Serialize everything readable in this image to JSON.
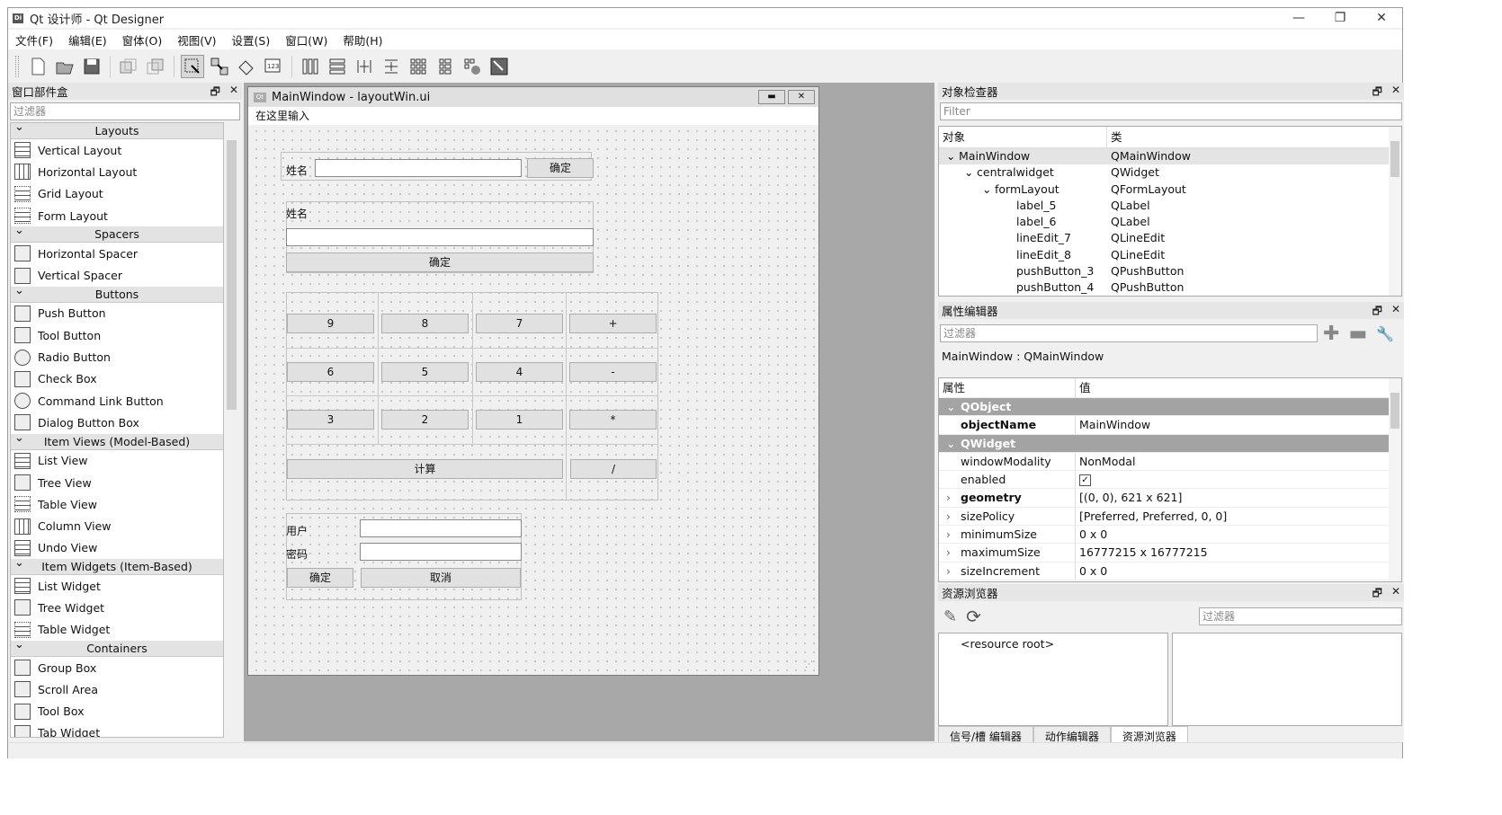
{
  "window": {
    "title": "Qt 设计师 - Qt Designer",
    "icon_label": "Di",
    "minimize": "—",
    "restore": "❐",
    "close": "✕"
  },
  "menu": [
    "文件(F)",
    "编辑(E)",
    "窗体(O)",
    "视图(V)",
    "设置(S)",
    "窗口(W)",
    "帮助(H)"
  ],
  "widget_box": {
    "title": "窗口部件盒",
    "filter_placeholder": "过滤器",
    "categories": [
      {
        "name": "Layouts",
        "items": [
          "Vertical Layout",
          "Horizontal Layout",
          "Grid Layout",
          "Form Layout"
        ]
      },
      {
        "name": "Spacers",
        "items": [
          "Horizontal Spacer",
          "Vertical Spacer"
        ]
      },
      {
        "name": "Buttons",
        "items": [
          "Push Button",
          "Tool Button",
          "Radio Button",
          "Check Box",
          "Command Link Button",
          "Dialog Button Box"
        ]
      },
      {
        "name": "Item Views (Model-Based)",
        "items": [
          "List View",
          "Tree View",
          "Table View",
          "Column View",
          "Undo View"
        ]
      },
      {
        "name": "Item Widgets (Item-Based)",
        "items": [
          "List Widget",
          "Tree Widget",
          "Table Widget"
        ]
      },
      {
        "name": "Containers",
        "items": [
          "Group Box",
          "Scroll Area",
          "Tool Box",
          "Tab Widget"
        ]
      }
    ]
  },
  "form": {
    "title": "MainWindow - layoutWin.ui",
    "icon_label": "Qt",
    "menu_placeholder": "在这里输入",
    "row1_label": "姓名",
    "row1_button": "确定",
    "row2_label": "姓名",
    "row2_button": "确定",
    "grid_buttons": [
      "9",
      "8",
      "7",
      "+",
      "6",
      "5",
      "4",
      "-",
      "3",
      "2",
      "1",
      "*"
    ],
    "calc_button": "计算",
    "div_button": "/",
    "user_label": "用户",
    "pass_label": "密码",
    "ok_button": "确定",
    "cancel_button": "取消"
  },
  "object_inspector": {
    "title": "对象检查器",
    "filter_placeholder": "Filter",
    "col_object": "对象",
    "col_class": "类",
    "rows": [
      {
        "name": "MainWindow",
        "class": "QMainWindow",
        "indent": 0,
        "expand": "⌄"
      },
      {
        "name": "centralwidget",
        "class": "QWidget",
        "indent": 1,
        "expand": "⌄"
      },
      {
        "name": "formLayout",
        "class": "QFormLayout",
        "indent": 2,
        "expand": "⌄"
      },
      {
        "name": "label_5",
        "class": "QLabel",
        "indent": 3,
        "expand": ""
      },
      {
        "name": "label_6",
        "class": "QLabel",
        "indent": 3,
        "expand": ""
      },
      {
        "name": "lineEdit_7",
        "class": "QLineEdit",
        "indent": 3,
        "expand": ""
      },
      {
        "name": "lineEdit_8",
        "class": "QLineEdit",
        "indent": 3,
        "expand": ""
      },
      {
        "name": "pushButton_3",
        "class": "QPushButton",
        "indent": 3,
        "expand": ""
      },
      {
        "name": "pushButton_4",
        "class": "QPushButton",
        "indent": 3,
        "expand": ""
      }
    ]
  },
  "property_editor": {
    "title": "属性编辑器",
    "filter_placeholder": "过滤器",
    "object_class": "MainWindow : QMainWindow",
    "col_property": "属性",
    "col_value": "值",
    "rows": [
      {
        "type": "group",
        "name": "QObject"
      },
      {
        "type": "prop",
        "name": "objectName",
        "value": "MainWindow",
        "bold": true,
        "expandable": false
      },
      {
        "type": "group",
        "name": "QWidget"
      },
      {
        "type": "prop",
        "name": "windowModality",
        "value": "NonModal",
        "bold": false,
        "expandable": false
      },
      {
        "type": "prop",
        "name": "enabled",
        "value": "✓",
        "bold": false,
        "expandable": false,
        "checkbox": true
      },
      {
        "type": "prop",
        "name": "geometry",
        "value": "[(0, 0), 621 x 621]",
        "bold": true,
        "expandable": true
      },
      {
        "type": "prop",
        "name": "sizePolicy",
        "value": "[Preferred, Preferred, 0, 0]",
        "bold": false,
        "expandable": true
      },
      {
        "type": "prop",
        "name": "minimumSize",
        "value": "0 x 0",
        "bold": false,
        "expandable": true
      },
      {
        "type": "prop",
        "name": "maximumSize",
        "value": "16777215 x 16777215",
        "bold": false,
        "expandable": true
      },
      {
        "type": "prop",
        "name": "sizeIncrement",
        "value": "0 x 0",
        "bold": false,
        "expandable": true
      }
    ]
  },
  "resource_browser": {
    "title": "资源浏览器",
    "filter_placeholder": "过滤器",
    "root": "<resource root>"
  },
  "bottom_tabs": [
    "信号/槽 编辑器",
    "动作编辑器",
    "资源浏览器"
  ],
  "dock_float": "🗗",
  "dock_close": "✕"
}
